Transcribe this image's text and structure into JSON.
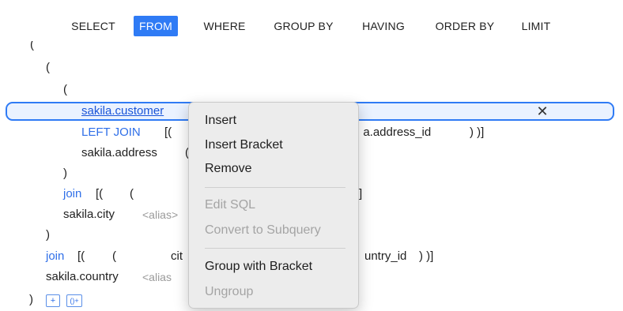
{
  "tabs": [
    {
      "label": "SELECT",
      "active": false
    },
    {
      "label": "FROM",
      "active": true
    },
    {
      "label": "WHERE",
      "active": false
    },
    {
      "label": "GROUP BY",
      "active": false
    },
    {
      "label": "HAVING",
      "active": false
    },
    {
      "label": "ORDER BY",
      "active": false
    },
    {
      "label": "LIMIT",
      "active": false
    }
  ],
  "editor": {
    "paren_top_cut": "(",
    "paren_l1": "(",
    "paren_l2": "(",
    "selected_table": "sakila.customer",
    "left_join_kw": "LEFT JOIN",
    "left_join_open": "[(",
    "left_join_cond_tail": ": a.address_id",
    "left_join_close": ") )]",
    "address_table": "sakila.address",
    "address_paren_fragment": "(",
    "close_l2": ")",
    "join1_kw": "join",
    "join1_open": "[(",
    "join1_paren": "(",
    "join1_close": "]",
    "city_table": "sakila.city",
    "alias_placeholder": "<alias>",
    "close_l1": ")",
    "join2_kw": "join",
    "join2_open": "[(",
    "join2_paren": "(",
    "join2_frag_left": "cit",
    "join2_frag_right": "untry_id",
    "join2_close": ") )]",
    "country_table": "sakila.country",
    "country_alias_fragment": "<alias",
    "close_root": ")",
    "add_button": "+",
    "add_group_button": "()+",
    "close_icon_glyph": "✕"
  },
  "context_menu": {
    "items": [
      {
        "label": "Insert",
        "enabled": true
      },
      {
        "label": "Insert Bracket",
        "enabled": true
      },
      {
        "label": "Remove",
        "enabled": true
      },
      {
        "label": "Edit SQL",
        "enabled": false
      },
      {
        "label": "Convert to Subquery",
        "enabled": false
      },
      {
        "label": "Group with Bracket",
        "enabled": true
      },
      {
        "label": "Ungroup",
        "enabled": false
      }
    ]
  },
  "colors": {
    "accent": "#2f7bf5",
    "keyword": "#2f6fe8",
    "selection_bg": "#eaf2ff",
    "alias_gray": "#9a9a9a",
    "menu_bg": "#ececec"
  }
}
